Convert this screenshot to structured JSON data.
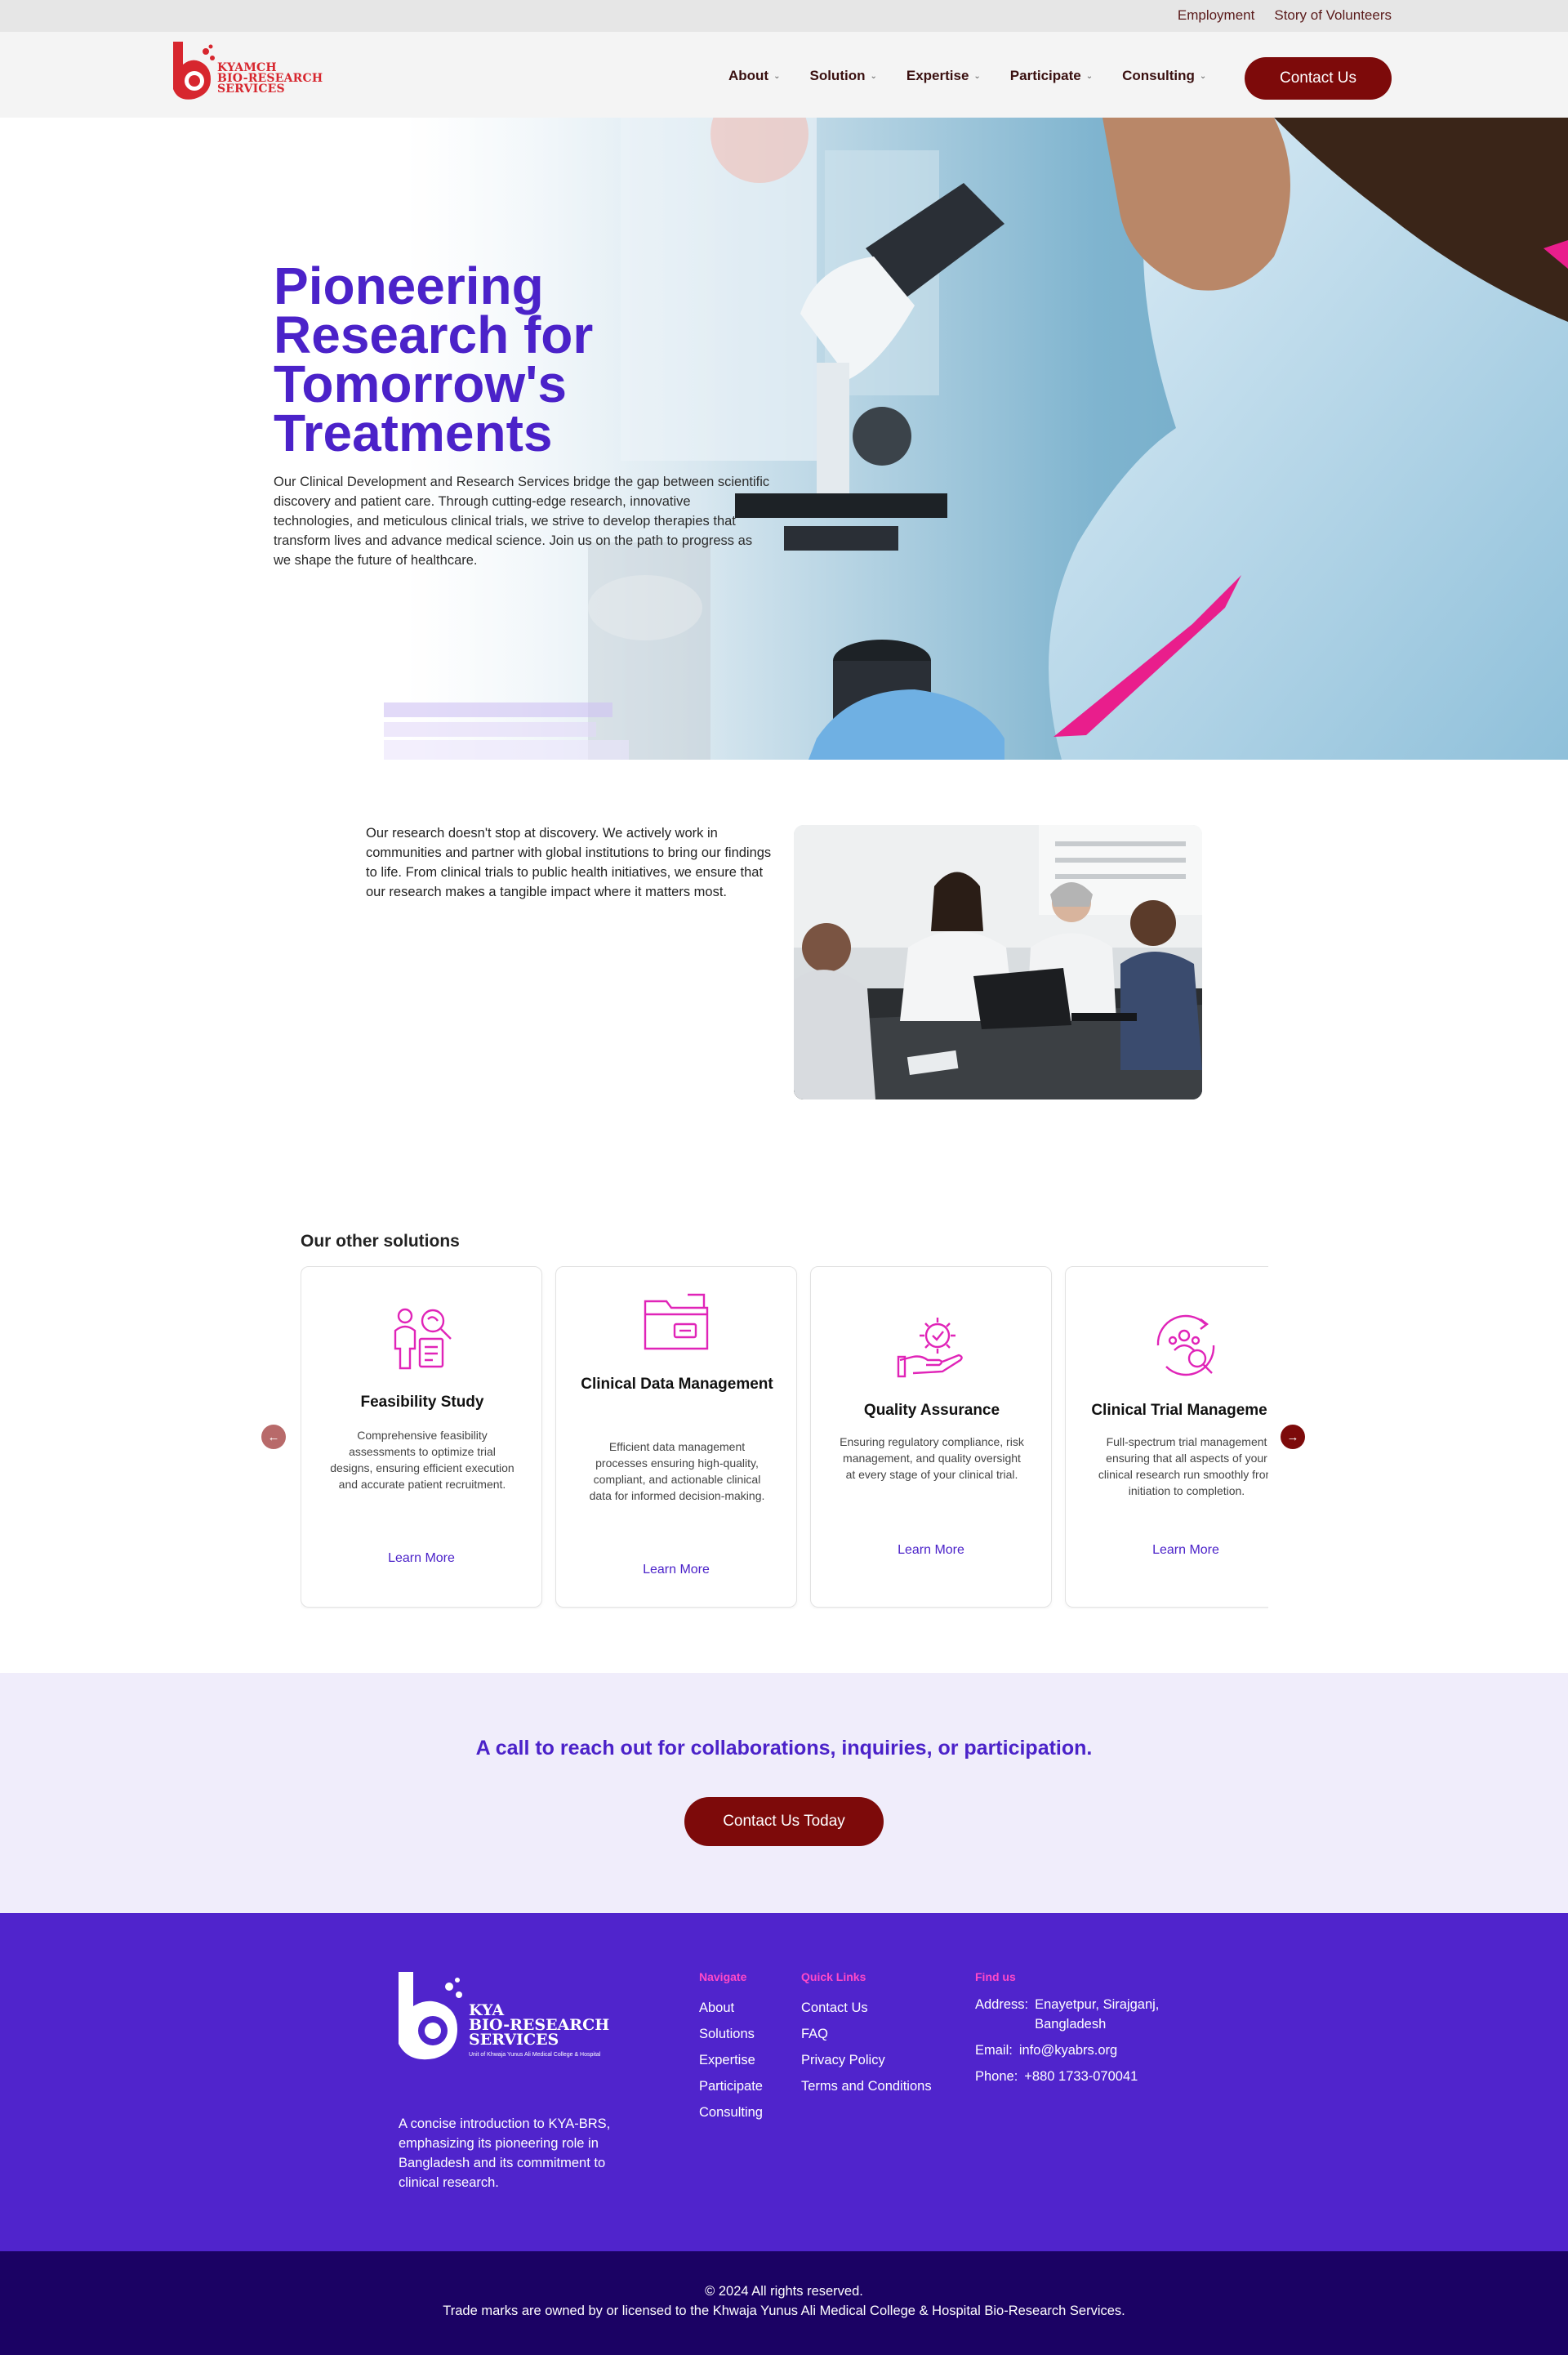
{
  "utility_bar": {
    "links": [
      "Employment",
      "Story of Volunteers"
    ]
  },
  "header": {
    "logo_text_line1": "KYAMCH",
    "logo_text_line2": "BIO-RESEARCH",
    "logo_text_line3": "SERVICES",
    "nav": [
      "About",
      "Solution",
      "Expertise",
      "Participate",
      "Consulting"
    ],
    "contact_label": "Contact Us"
  },
  "hero": {
    "title": "Pioneering Research for Tomorrow's Treatments",
    "text": "Our Clinical Development and Research Services bridge the gap between scientific discovery and patient care. Through cutting-edge research, innovative technologies, and meticulous clinical trials, we strive to develop therapies that transform lives and advance medical science. Join us on the path to progress as we shape the future of healthcare."
  },
  "intro": {
    "text": "Our research doesn't stop at discovery. We actively work in communities and partner with global institutions to bring our findings to life. From clinical trials to public health initiatives, we ensure that our research makes a tangible impact where it matters most."
  },
  "solutions": {
    "heading": "Our other solutions",
    "cards": [
      {
        "icon": "feasibility-icon",
        "title": "Feasibility Study",
        "desc": "Comprehensive feasibility assessments to optimize trial designs, ensuring efficient execution and accurate patient recruitment.",
        "link": "Learn More"
      },
      {
        "icon": "folder-icon",
        "title": "Clinical Data Management",
        "desc": "Efficient data management processes ensuring high-quality, compliant, and actionable clinical data for informed decision-making.",
        "link": "Learn More"
      },
      {
        "icon": "gear-hand-icon",
        "title": "Quality Assurance",
        "desc": "Ensuring regulatory compliance, risk management, and quality oversight at every stage of your clinical trial.",
        "link": "Learn More"
      },
      {
        "icon": "group-search-icon",
        "title": "Clinical Trial Management",
        "desc": "Full-spectrum trial management ensuring that all aspects of your clinical research run smoothly from initiation to completion.",
        "link": "Learn More"
      }
    ]
  },
  "cta": {
    "text": "A call to reach out for collaborations, inquiries, or participation.",
    "button": "Contact Us Today"
  },
  "footer": {
    "logo_line1": "KYA",
    "logo_line2": "BIO-RESEARCH",
    "logo_line3": "SERVICES",
    "logo_sub": "Unit of Khwaja Yunus Ali Medical College & Hospital",
    "about": "A concise introduction to KYA-BRS, emphasizing its pioneering role in Bangladesh and its commitment to clinical research.",
    "navigate_head": "Navigate",
    "navigate": [
      "About",
      "Solutions",
      "Expertise",
      "Participate",
      "Consulting"
    ],
    "quick_head": "Quick Links",
    "quick": [
      "Contact Us",
      "FAQ",
      "Privacy Policy",
      "Terms and Conditions"
    ],
    "find_head": "Find us",
    "address_label": "Address:",
    "address": "Enayetpur, Sirajganj, Bangladesh",
    "email_label": "Email:",
    "email": "info@kyabrs.org",
    "phone_label": "Phone:",
    "phone": "+880 1733-070041"
  },
  "bottom": {
    "line1": "© 2024 All rights reserved.",
    "line2": "Trade marks are owned by or licensed to the Khwaja Yunus Ali Medical College & Hospital Bio-Research Services."
  },
  "colors": {
    "brand_purple": "#4b22c9",
    "brand_maroon": "#7d0a0a",
    "accent_pink": "#ff49c8",
    "footer_bg": "#5024cc",
    "bottom_bg": "#1b0264"
  }
}
